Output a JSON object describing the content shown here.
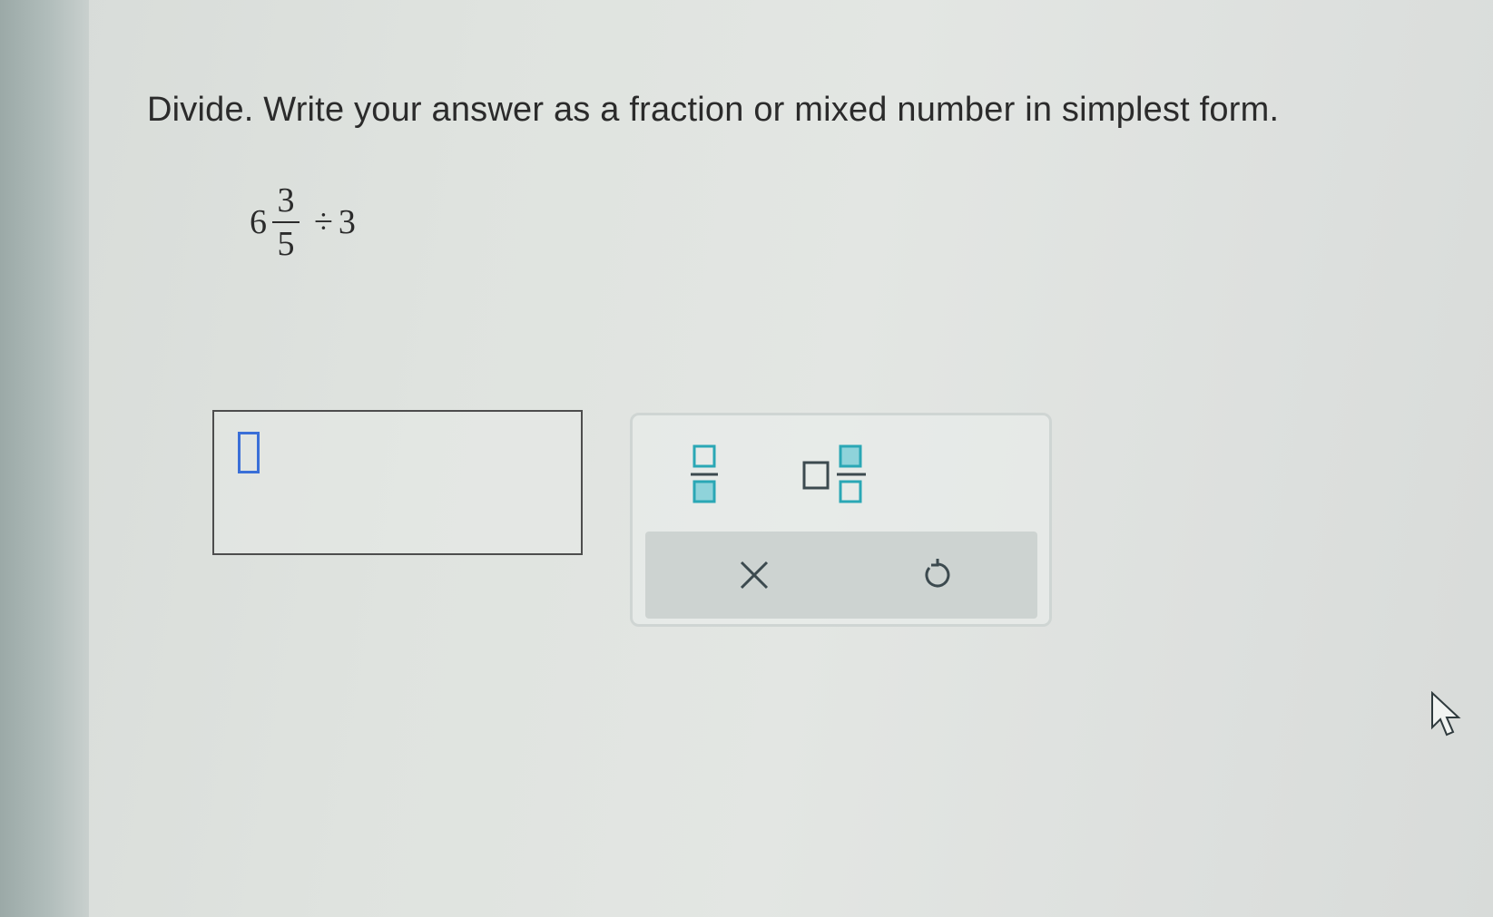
{
  "question": {
    "instruction": "Divide. Write your answer as a fraction or mixed number in simplest form.",
    "expression": {
      "whole": "6",
      "numerator": "3",
      "denominator": "5",
      "operator": "÷",
      "divisor": "3"
    }
  },
  "answer_input": {
    "value": ""
  },
  "palette": {
    "tools": [
      "fraction-template",
      "mixed-number-template"
    ],
    "actions": {
      "clear_label": "×",
      "undo_icon": "undo-icon"
    }
  },
  "colors": {
    "accent": "#2aa7b5",
    "cursor": "#3a6fd8",
    "text": "#2b2b2b",
    "border": "#4d4d4d"
  }
}
